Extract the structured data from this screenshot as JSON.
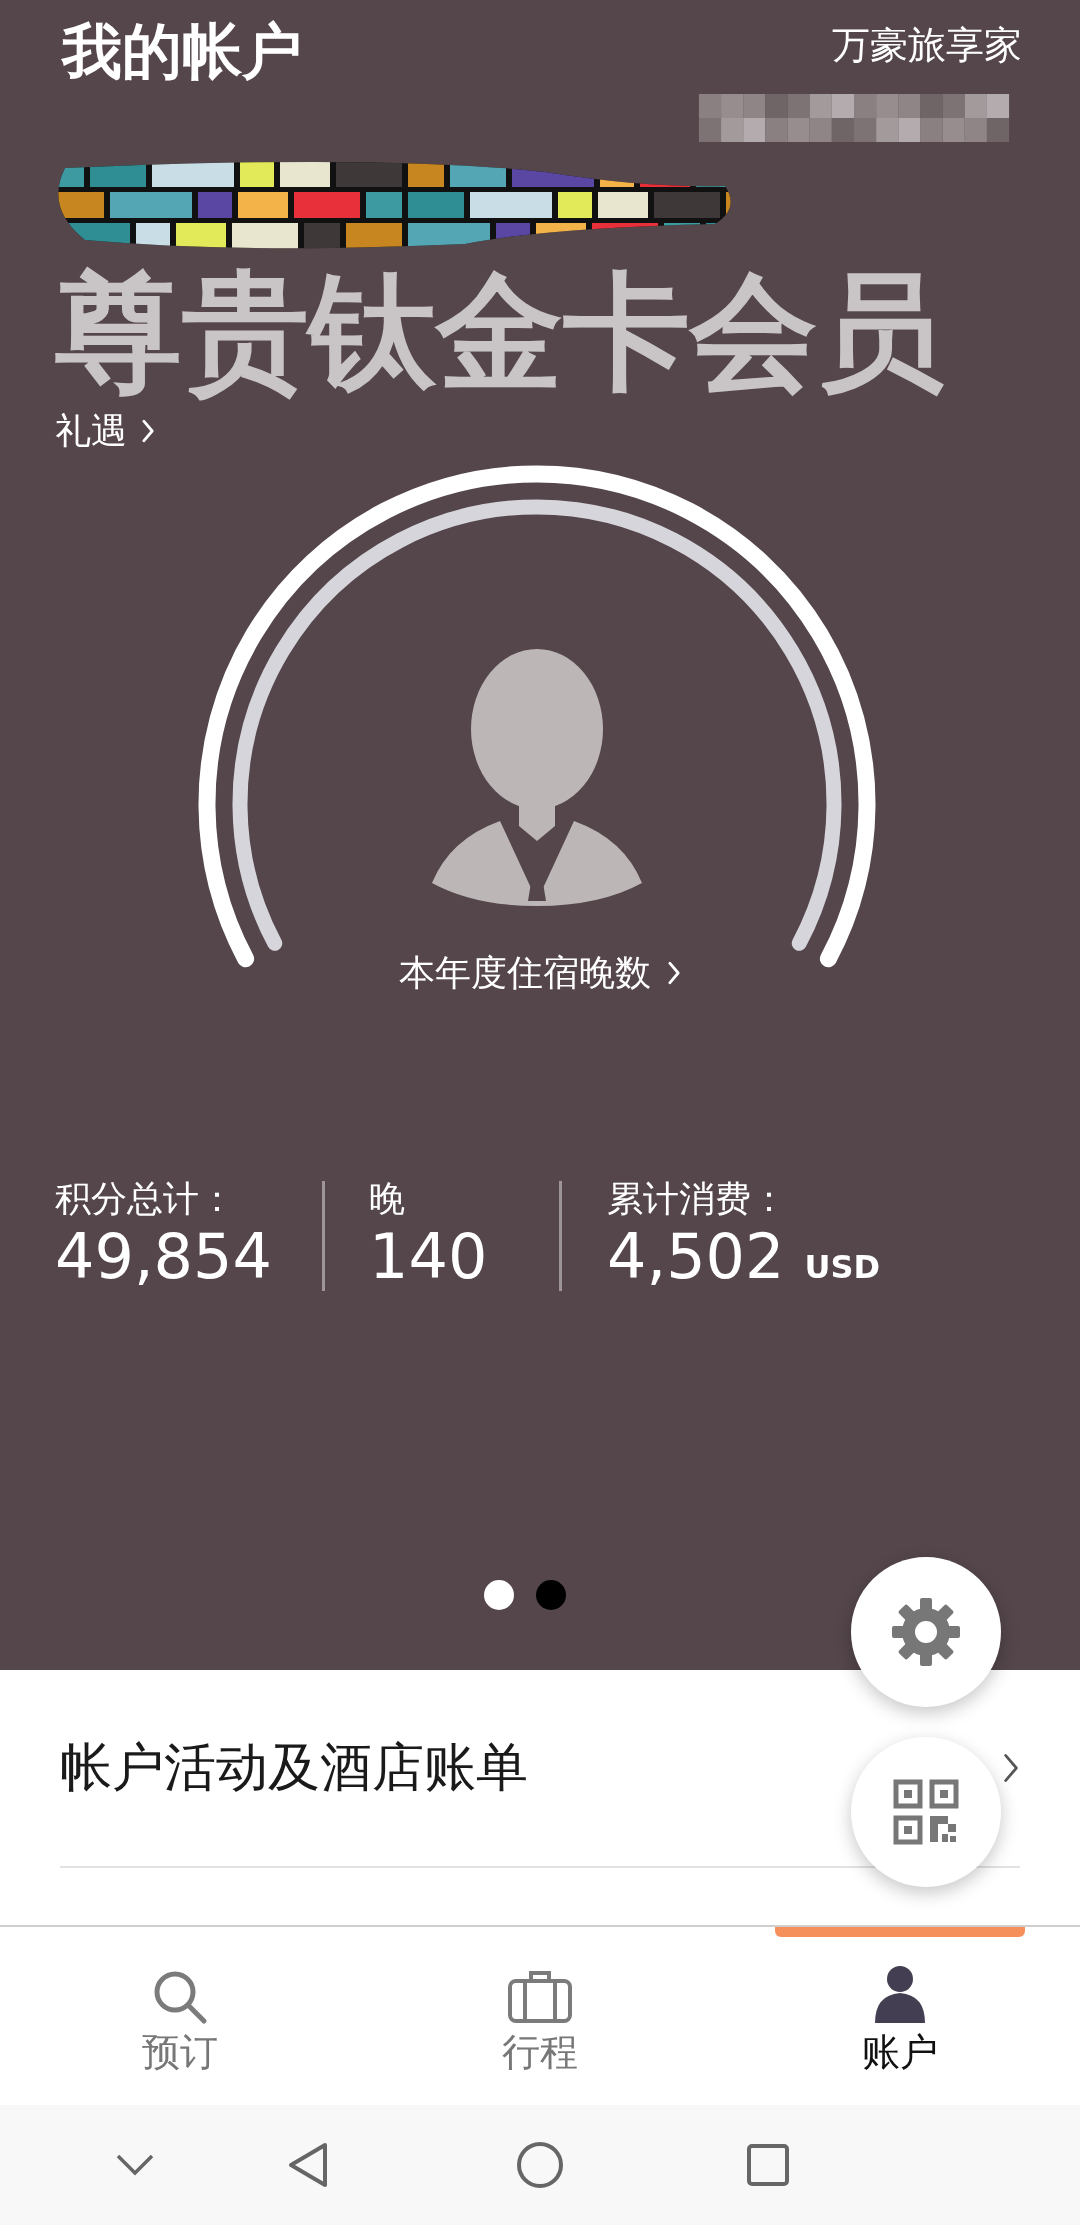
{
  "header": {
    "title": "我的帐户",
    "brand": "万豪旅享家"
  },
  "member_number": {
    "kind": "redacted"
  },
  "member_name": {
    "kind": "redacted"
  },
  "tier": {
    "name": "尊贵钛金卡会员",
    "benefits_link": "礼遇"
  },
  "nights_gauge": {
    "label": "本年度住宿晚数"
  },
  "stats": [
    {
      "label": "积分总计：",
      "value": "49,854"
    },
    {
      "label": "晚",
      "value": "140"
    },
    {
      "label": "累计消费：",
      "value": "4,502",
      "unit": "USD"
    }
  ],
  "page_dots": [
    {
      "selected": false
    },
    {
      "selected": true
    }
  ],
  "menu": [
    {
      "label": "帐户活动及酒店账单"
    }
  ],
  "tabs": [
    {
      "label": "预订",
      "selected": false
    },
    {
      "label": "行程",
      "selected": false
    },
    {
      "label": "账户",
      "selected": true
    }
  ]
}
